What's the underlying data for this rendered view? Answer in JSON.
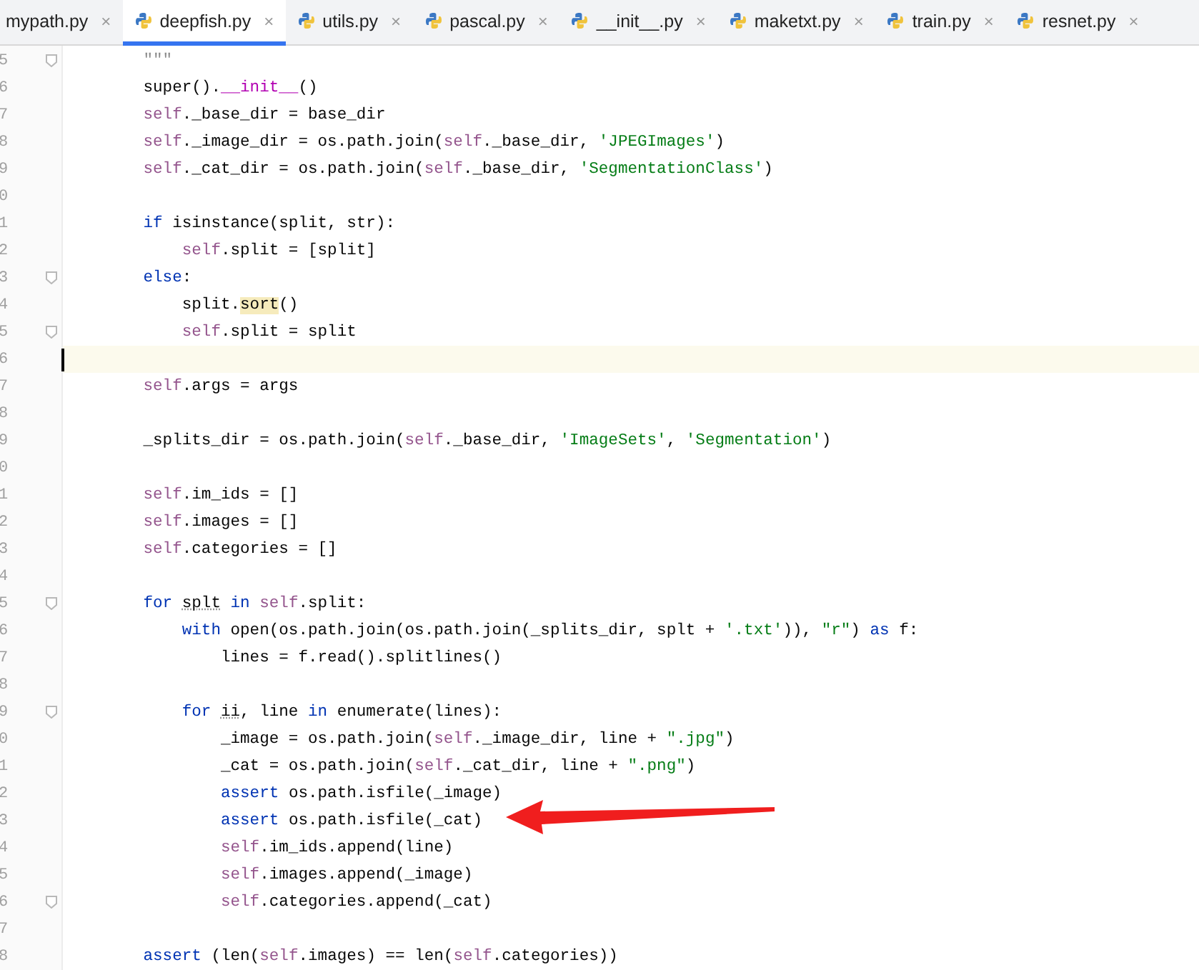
{
  "tabs": [
    {
      "label": "mypath.py",
      "selected": false,
      "icon": false,
      "close": "×"
    },
    {
      "label": "deepfish.py",
      "selected": true,
      "icon": true,
      "close": "×"
    },
    {
      "label": "utils.py",
      "selected": false,
      "icon": true,
      "close": "×"
    },
    {
      "label": "pascal.py",
      "selected": false,
      "icon": true,
      "close": "×"
    },
    {
      "label": "__init__.py",
      "selected": false,
      "icon": true,
      "close": "×"
    },
    {
      "label": "maketxt.py",
      "selected": false,
      "icon": true,
      "close": "×"
    },
    {
      "label": "train.py",
      "selected": false,
      "icon": true,
      "close": "×"
    },
    {
      "label": "resnet.py",
      "selected": false,
      "icon": true,
      "close": "×"
    }
  ],
  "lines": [
    {
      "n": "5",
      "fold": true,
      "tokens": [
        {
          "t": "        \"\"\"",
          "kind": "doc"
        }
      ]
    },
    {
      "n": "6",
      "tokens": [
        {
          "t": "        super().",
          "kind": "plain"
        },
        {
          "t": "__init__",
          "kind": "dunder"
        },
        {
          "t": "()",
          "kind": "plain"
        }
      ]
    },
    {
      "n": "7",
      "tokens": [
        {
          "t": "        self",
          "kind": "self"
        },
        {
          "t": "._base_dir = base_dir",
          "kind": "plain"
        }
      ]
    },
    {
      "n": "8",
      "tokens": [
        {
          "t": "        self",
          "kind": "self"
        },
        {
          "t": "._image_dir = os.path.join(",
          "kind": "plain"
        },
        {
          "t": "self",
          "kind": "self"
        },
        {
          "t": "._base_dir, ",
          "kind": "plain"
        },
        {
          "t": "'JPEGImages'",
          "kind": "str"
        },
        {
          "t": ")",
          "kind": "plain"
        }
      ]
    },
    {
      "n": "9",
      "tokens": [
        {
          "t": "        self",
          "kind": "self"
        },
        {
          "t": "._cat_dir = os.path.join(",
          "kind": "plain"
        },
        {
          "t": "self",
          "kind": "self"
        },
        {
          "t": "._base_dir, ",
          "kind": "plain"
        },
        {
          "t": "'SegmentationClass'",
          "kind": "str"
        },
        {
          "t": ")",
          "kind": "plain"
        }
      ]
    },
    {
      "n": "0"
    },
    {
      "n": "1",
      "tokens": [
        {
          "t": "        if ",
          "kind": "kw"
        },
        {
          "t": "isinstance(split, str):",
          "kind": "plain"
        }
      ]
    },
    {
      "n": "2",
      "tokens": [
        {
          "t": "            self",
          "kind": "self"
        },
        {
          "t": ".split = [split]",
          "kind": "plain"
        }
      ]
    },
    {
      "n": "3",
      "fold": true,
      "tokens": [
        {
          "t": "        else",
          "kind": "kw"
        },
        {
          "t": ":",
          "kind": "plain"
        }
      ]
    },
    {
      "n": "4",
      "tokens": [
        {
          "t": "            split.",
          "kind": "plain"
        },
        {
          "t": "sort",
          "kind": "match"
        },
        {
          "t": "()",
          "kind": "plain"
        }
      ]
    },
    {
      "n": "5",
      "fold": true,
      "tokens": [
        {
          "t": "            self",
          "kind": "self"
        },
        {
          "t": ".split = split",
          "kind": "plain"
        }
      ]
    },
    {
      "n": "6",
      "current": true
    },
    {
      "n": "7",
      "tokens": [
        {
          "t": "        self",
          "kind": "self"
        },
        {
          "t": ".args = args",
          "kind": "plain"
        }
      ]
    },
    {
      "n": "8"
    },
    {
      "n": "9",
      "tokens": [
        {
          "t": "        _splits_dir = os.path.join(",
          "kind": "plain"
        },
        {
          "t": "self",
          "kind": "self"
        },
        {
          "t": "._base_dir, ",
          "kind": "plain"
        },
        {
          "t": "'ImageSets'",
          "kind": "str"
        },
        {
          "t": ", ",
          "kind": "plain"
        },
        {
          "t": "'Segmentation'",
          "kind": "str"
        },
        {
          "t": ")",
          "kind": "plain"
        }
      ]
    },
    {
      "n": "0"
    },
    {
      "n": "1",
      "tokens": [
        {
          "t": "        self",
          "kind": "self"
        },
        {
          "t": ".im_ids = []",
          "kind": "plain"
        }
      ]
    },
    {
      "n": "2",
      "tokens": [
        {
          "t": "        self",
          "kind": "self"
        },
        {
          "t": ".images = []",
          "kind": "plain"
        }
      ]
    },
    {
      "n": "3",
      "tokens": [
        {
          "t": "        self",
          "kind": "self"
        },
        {
          "t": ".categories = []",
          "kind": "plain"
        }
      ]
    },
    {
      "n": "4"
    },
    {
      "n": "5",
      "fold": true,
      "tokens": [
        {
          "t": "        for ",
          "kind": "kw"
        },
        {
          "t": "splt",
          "kind": "typo"
        },
        {
          "t": " in ",
          "kind": "kw"
        },
        {
          "t": "self",
          "kind": "self"
        },
        {
          "t": ".split:",
          "kind": "plain"
        }
      ]
    },
    {
      "n": "6",
      "tokens": [
        {
          "t": "            with ",
          "kind": "kw"
        },
        {
          "t": "open(os.path.join(os.path.join(_splits_dir, splt + ",
          "kind": "plain"
        },
        {
          "t": "'.txt'",
          "kind": "str"
        },
        {
          "t": ")), ",
          "kind": "plain"
        },
        {
          "t": "\"r\"",
          "kind": "str"
        },
        {
          "t": ") ",
          "kind": "plain"
        },
        {
          "t": "as ",
          "kind": "kw"
        },
        {
          "t": "f:",
          "kind": "plain"
        }
      ]
    },
    {
      "n": "7",
      "tokens": [
        {
          "t": "                lines = f.read().splitlines()",
          "kind": "plain"
        }
      ]
    },
    {
      "n": "8"
    },
    {
      "n": "9",
      "fold": true,
      "tokens": [
        {
          "t": "            for ",
          "kind": "kw"
        },
        {
          "t": "ii",
          "kind": "typo"
        },
        {
          "t": ", line ",
          "kind": "plain"
        },
        {
          "t": "in ",
          "kind": "kw"
        },
        {
          "t": "enumerate(lines):",
          "kind": "plain"
        }
      ]
    },
    {
      "n": "0",
      "tokens": [
        {
          "t": "                _image = os.path.join(",
          "kind": "plain"
        },
        {
          "t": "self",
          "kind": "self"
        },
        {
          "t": "._image_dir, line + ",
          "kind": "plain"
        },
        {
          "t": "\".jpg\"",
          "kind": "str"
        },
        {
          "t": ")",
          "kind": "plain"
        }
      ]
    },
    {
      "n": "1",
      "tokens": [
        {
          "t": "                _cat = os.path.join(",
          "kind": "plain"
        },
        {
          "t": "self",
          "kind": "self"
        },
        {
          "t": "._cat_dir, line + ",
          "kind": "plain"
        },
        {
          "t": "\".png\"",
          "kind": "str"
        },
        {
          "t": ")",
          "kind": "plain"
        }
      ]
    },
    {
      "n": "2",
      "tokens": [
        {
          "t": "                assert ",
          "kind": "kw"
        },
        {
          "t": "os.path.isfile(_image)",
          "kind": "plain"
        }
      ]
    },
    {
      "n": "3",
      "tokens": [
        {
          "t": "                assert ",
          "kind": "kw"
        },
        {
          "t": "os.path.isfile(_cat)",
          "kind": "plain"
        }
      ]
    },
    {
      "n": "4",
      "tokens": [
        {
          "t": "                self",
          "kind": "self"
        },
        {
          "t": ".im_ids.append(line)",
          "kind": "plain"
        }
      ]
    },
    {
      "n": "5",
      "tokens": [
        {
          "t": "                self",
          "kind": "self"
        },
        {
          "t": ".images.append(_image)",
          "kind": "plain"
        }
      ]
    },
    {
      "n": "6",
      "fold": true,
      "tokens": [
        {
          "t": "                self",
          "kind": "self"
        },
        {
          "t": ".categories.append(_cat)",
          "kind": "plain"
        }
      ]
    },
    {
      "n": "7"
    },
    {
      "n": "8",
      "tokens": [
        {
          "t": "        assert ",
          "kind": "kw"
        },
        {
          "t": "(len(",
          "kind": "plain"
        },
        {
          "t": "self",
          "kind": "self"
        },
        {
          "t": ".images) == len(",
          "kind": "plain"
        },
        {
          "t": "self",
          "kind": "self"
        },
        {
          "t": ".categories))",
          "kind": "plain"
        }
      ]
    }
  ]
}
